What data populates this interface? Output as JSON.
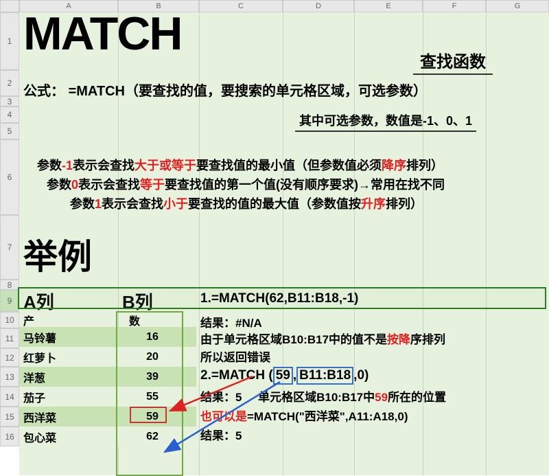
{
  "columns": [
    "A",
    "B",
    "C",
    "D",
    "E",
    "F",
    "G"
  ],
  "rows": [
    "1",
    "2",
    "3",
    "4",
    "5",
    "6",
    "7",
    "8",
    "9",
    "10",
    "11",
    "12",
    "13",
    "14",
    "15",
    "16"
  ],
  "title": "MATCH",
  "subtitle": "查找函数",
  "formula_label": "公式：",
  "formula_text": "=MATCH（要查找的值，要搜索的单元格区域，可选参数）",
  "optional_text": "其中可选参数，数值是-1、0、1",
  "explain": {
    "l1a": "参数",
    "l1b": "-1",
    "l1c": "表示会查找",
    "l1d": "大于或等于",
    "l1e": "要查找值的最小值（但参数值必须",
    "l1f": "降序",
    "l1g": "排列）",
    "l2a": "参数",
    "l2b": "0",
    "l2c": "表示会查找",
    "l2d": "等于",
    "l2e": "要查找值的第一个值(没有顺序要求)→常用在找不同",
    "l3a": "参数",
    "l3b": "1",
    "l3c": "表示会查找",
    "l3d": "小于",
    "l3e": "要查找的值的最大值（参数值按",
    "l3f": "升序",
    "l3g": "排列）"
  },
  "example_title": "举例",
  "col_a_head": "A列",
  "col_b_head": "B列",
  "prod_label": "产品",
  "qty_label": "数量",
  "products": [
    {
      "name": "马铃薯",
      "qty": "16"
    },
    {
      "name": "红萝卜",
      "qty": "20"
    },
    {
      "name": "洋葱",
      "qty": "39"
    },
    {
      "name": "茄子",
      "qty": "55"
    },
    {
      "name": "西洋菜",
      "qty": "59"
    },
    {
      "name": "包心菜",
      "qty": "62"
    }
  ],
  "right": {
    "r1": "1.=MATCH(62,B11:B18,-1)",
    "r2a": "结果：",
    "r2b": "#N/A",
    "r3a": "由于单元格区域B10:B17中的值不是",
    "r3b": "按降",
    "r3c": "序排列",
    "r4": "所以返回错误",
    "r5a": "2.=MATCH",
    "r5b": "59",
    "r5c": "B11:B18",
    "r5d": ",0)",
    "r6a": "结果：",
    "r6b": "5",
    "r6c": "单元格区域B10:B17中",
    "r6d": "59",
    "r6e": "所在的位置",
    "r7a": "也可以是",
    "r7b": "=MATCH(\"西洋菜\",A11:A18,0)",
    "r8a": "结果：",
    "r8b": "5"
  }
}
